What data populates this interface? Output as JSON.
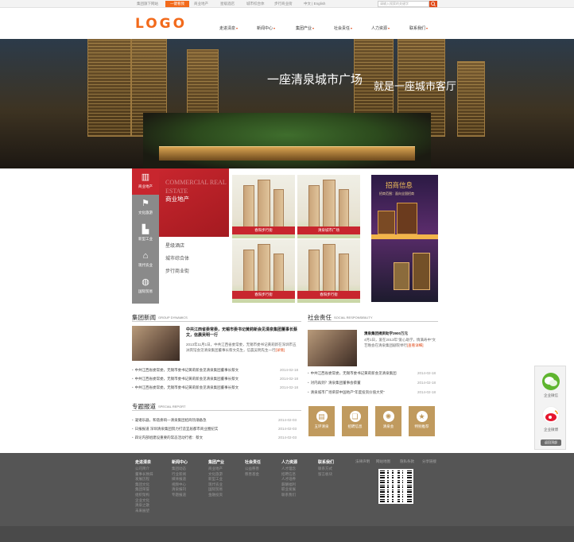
{
  "topbar": {
    "left_links": [
      "集团旗下网站",
      "商业地产",
      "星级酒店",
      "城市综合体",
      "步行商业街"
    ],
    "current_label": "一键看我",
    "lang": "中文 | English",
    "search_placeholder": "请输入搜索的关键字"
  },
  "logo": "LOGO",
  "nav": [
    "走进清泉",
    "新闻中心",
    "集团产业",
    "社会责任",
    "人力资源",
    "联系我们"
  ],
  "hero": {
    "line1": "一座清泉城市广场",
    "line2": "就是一座城市客厅"
  },
  "side_tabs": [
    "商业地产",
    "文化旅游",
    "新型工业",
    "现代农业",
    "国际贸易"
  ],
  "category": {
    "en": "COMMERCIAL REAL ESTATE",
    "title": "商业地产",
    "links": [
      "星级酒店",
      "城市综合体",
      "步行商业街"
    ]
  },
  "thumbs": [
    "春阳步行街",
    "清泉城市广场",
    "春阳步行街",
    "春阳步行街"
  ],
  "promo": {
    "title": "招商信息",
    "subtitle": "招商范围：面向全国招商"
  },
  "group_news": {
    "title": "集团新闻",
    "en": "GROUP DYNAMICS",
    "headline": "中共江西省委常委，无锡市委书记黄莉新会见清泉集团董事长蔡文，信晨吴明一行",
    "summary": "2013年11月1日，中共江西省委常委，无锡市委书记黄莉新在深圳市五洲宾馆会见清泉集团董事长蔡文先生，信晨吴明先生一行",
    "more": "[详情]",
    "items": [
      {
        "t": "中共江西省委常委，无锡市委书记黄莉新会见清泉集团董事长蔡文",
        "d": "2014-02-18"
      },
      {
        "t": "中共江西省委常委，无锡市委书记黄莉新会见清泉集团董事长蔡文",
        "d": "2014-02-18"
      },
      {
        "t": "中共江西省委常委，无锡市委书记黄莉新会见清泉集团董事长蔡文",
        "d": "2014-02-18"
      }
    ]
  },
  "social": {
    "title": "社会责任",
    "en": "SOCIAL RESPONSIBILITY",
    "headline": "清泉集团捐资助学3900万元",
    "summary": "4月1日，爱在2013年“爱心助学，情满寿中”文艺晚会在清泉集团剧院举行",
    "more": "[查看详细]",
    "items": [
      {
        "t": "中共江西省委常委，无锡市委书记黄莉新会见清泉集团",
        "d": "2014-02-18"
      },
      {
        "t": "对内再到？清泉集团董事会蔡董",
        "d": "2014-02-18"
      },
      {
        "t": "清泉城市广场荣获中国地产“年度投资价值大奖”",
        "d": "2014-02-18"
      }
    ]
  },
  "special": {
    "title": "专题报道",
    "en": "SPECIAL REPORT",
    "items": [
      {
        "t": "凝诸乐器，和谐奏响—清泉集团招商热潮备急",
        "d": "2014-02-03"
      },
      {
        "t": "日报报道 深圳清泉集团努力打造宜居都市商业圈纪实",
        "d": "2014-02-03"
      },
      {
        "t": "四论内部组建设重要的常态活动行者：蔡文",
        "d": "2014-02-03"
      }
    ]
  },
  "icon_boxes": [
    "五环清泉",
    "招聘信息",
    "清泉会",
    "特别推荐"
  ],
  "footer": {
    "cols": [
      {
        "h": "走进清泉",
        "items": [
          "公司简介",
          "董事长致辞",
          "发展历程",
          "集团文化",
          "集团荣誉",
          "组织架构",
          "企业文化",
          "清泉之歌",
          "未来展望"
        ]
      },
      {
        "h": "新闻中心",
        "items": [
          "集团动态",
          "行业新闻",
          "媒体报道",
          "视频中心",
          "清泉报刊",
          "专题报道"
        ]
      },
      {
        "h": "集团产业",
        "items": [
          "商业地产",
          "文化旅游",
          "新型工业",
          "现代农业",
          "国际贸易",
          "金融投资"
        ]
      },
      {
        "h": "社会责任",
        "items": [
          "公益慈善",
          "慈善基金"
        ]
      },
      {
        "h": "人力资源",
        "items": [
          "人才理念",
          "招聘信息",
          "人才培养",
          "薪酬福利",
          "职业发展",
          "联系我们"
        ]
      },
      {
        "h": "联系我们",
        "items": [
          "联系方式",
          "留言板块"
        ]
      }
    ],
    "links": [
      "法律声明",
      "网站地图",
      "隐私条款",
      "分享链接"
    ]
  },
  "float": {
    "wechat": "企业微信",
    "weibo": "企业微博",
    "button": "返回顶部"
  }
}
